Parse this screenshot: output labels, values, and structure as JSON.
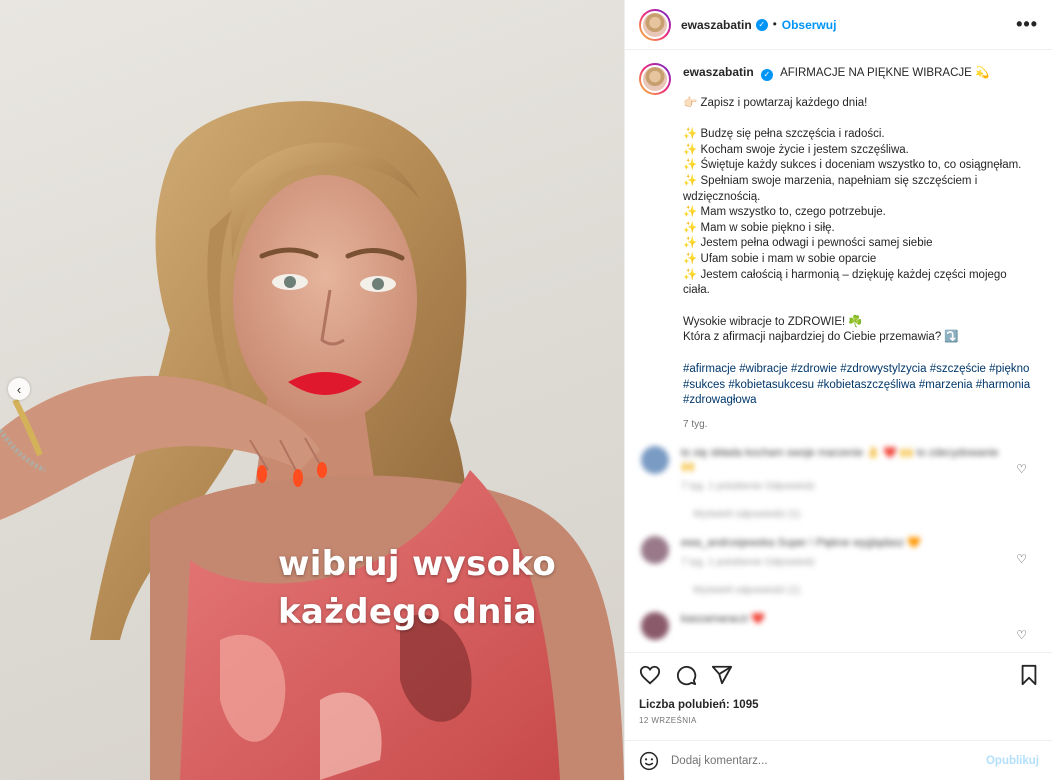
{
  "photo": {
    "overlay_line1": "wibruj wysoko",
    "overlay_line2": "każdego dnia",
    "prev_icon": "chevron-left-icon"
  },
  "header": {
    "username": "ewaszabatin",
    "separator": "•",
    "follow_label": "Obserwuj",
    "more_icon": "more-horizontal-icon",
    "more_label": "•••"
  },
  "caption": {
    "username": "ewaszabatin",
    "title": "AFIRMACJE NA PIĘKNE WIBRACJE 💫",
    "intro": "👉🏻 Zapisz i powtarzaj każdego dnia!",
    "lines": [
      "✨ Budzę się pełna szczęścia i radości.",
      "✨ Kocham swoje życie i jestem szczęśliwa.",
      "✨ Świętuje każdy sukces i doceniam wszystko to, co osiągnęłam.",
      "✨ Spełniam swoje marzenia, napełniam się szczęściem i wdzięcznością.",
      "✨ Mam wszystko to, czego potrzebuje.",
      "✨ Mam w sobie piękno i siłę.",
      "✨ Jestem pełna odwagi i pewności samej siebie",
      "✨ Ufam sobie i mam w sobie oparcie",
      "✨ Jestem całością i harmonią – dziękuję każdej części mojego ciała."
    ],
    "outro1": "Wysokie wibracje to ZDROWIE! ☘️",
    "outro2": "Która z afirmacji najbardziej do Ciebie przemawia? ⤵️",
    "hashtags": "#afirmacje #wibracje #zdrowie #zdrowystylzycia #szczęście #piękno #sukces #kobietasukcesu #kobietaszczęśliwa #marzenia #harmonia #zdrowagłowa",
    "time": "7 tyg."
  },
  "comments": [
    {
      "text": "to się składa kocham swoje marzenie 👌 ❤️ 🙌 to zdecydowanie 🙌",
      "meta": "7 tyg.   1 polubienie   Odpowiedz",
      "replies": "Wyświetl odpowiedzi (1)",
      "avatar_color": "#7a9bc4"
    },
    {
      "text": "ewa_andrzejewska Super ! Piękne wyglądasz 🧡",
      "meta": "7 tyg.   1 polubienie   Odpowiedz",
      "replies": "Wyświetl odpowiedzi (1)",
      "avatar_color": "#9a7a8a"
    },
    {
      "text": "kaszamaraczi ❤️",
      "meta": "",
      "replies": "",
      "avatar_color": "#8a5a6a"
    }
  ],
  "actions": {
    "like_icon": "heart-icon",
    "comment_icon": "comment-icon",
    "share_icon": "share-icon",
    "save_icon": "bookmark-icon"
  },
  "likes": "Liczba polubień: 1095",
  "date": "12 WRZEŚNIA",
  "add_comment": {
    "emoji_icon": "emoji-icon",
    "placeholder": "Dodaj komentarz...",
    "post_label": "Opublikuj"
  },
  "colors": {
    "link_blue": "#0095f6",
    "hashtag_blue": "#00376b",
    "muted": "#737373"
  }
}
